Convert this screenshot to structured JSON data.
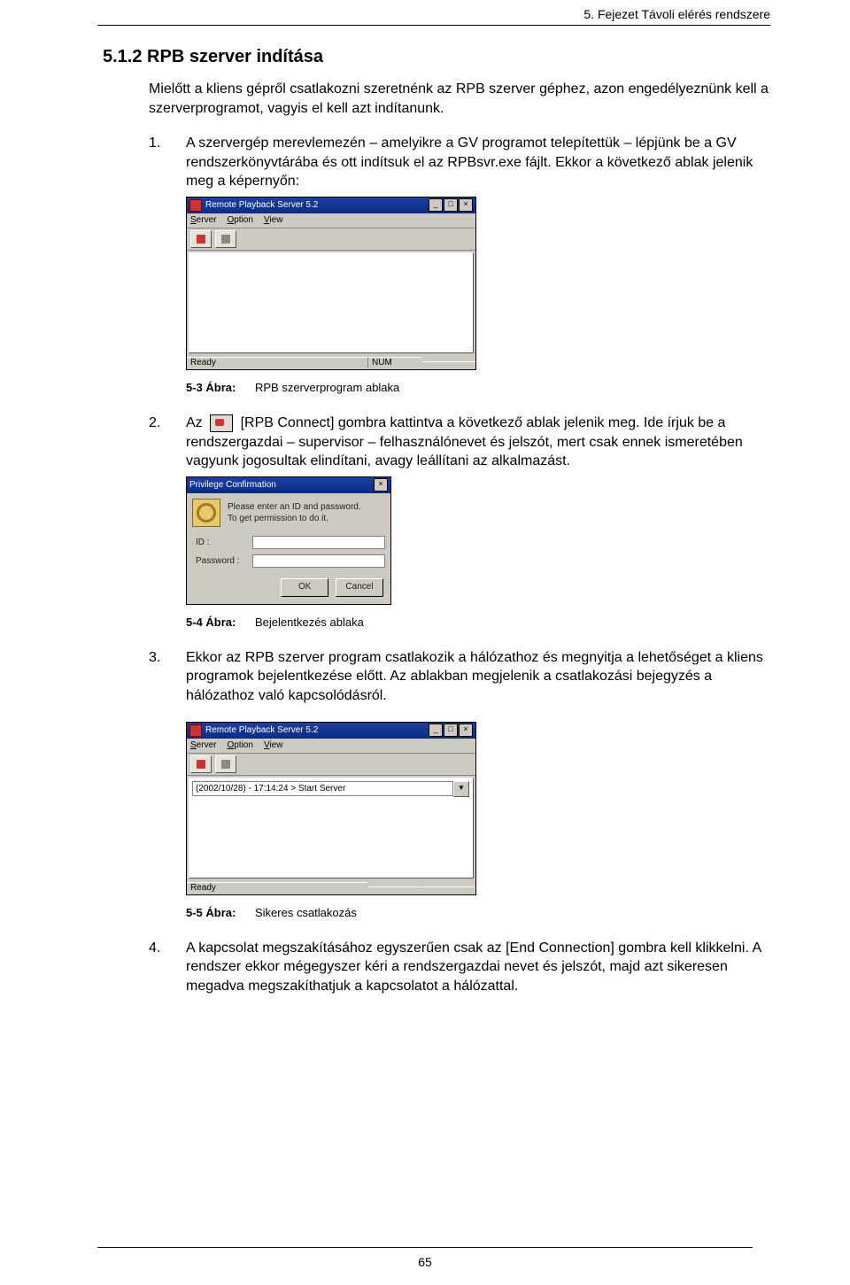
{
  "header": {
    "running": "5. Fejezet   Távoli elérés rendszere"
  },
  "section_title": "5.1.2 RPB szerver indítása",
  "intro": "Mielőtt a kliens gépről csatlakozni szeretnénk az RPB szerver géphez, azon engedélyeznünk kell a szerverprogramot, vagyis el kell azt indítanunk.",
  "item1": {
    "num": "1.",
    "text": "A szervergép merevlemezén – amelyikre a GV programot telepítettük – lépjünk be a GV rendszerkönyvtárába és ott indítsuk el az RPBsvr.exe fájlt. Ekkor a következő ablak jelenik meg a képernyőn:"
  },
  "fig1": {
    "title": "Remote Playback Server 5.2",
    "menus": {
      "server": "Server",
      "option": "Option",
      "view": "View"
    },
    "status_left": "Ready",
    "status_right": "NUM",
    "caption_label": "5-3 Ábra:",
    "caption_text": "RPB szerverprogram ablaka"
  },
  "item2": {
    "num": "2.",
    "pre": "Az",
    "post": "[RPB Connect] gombra kattintva a következő ablak jelenik meg. Ide írjuk be a rendszergazdai – supervisor – felhasználónevet és jelszót, mert csak ennek ismeretében vagyunk jogosultak elindítani, avagy leállítani az alkalmazást."
  },
  "dlg": {
    "title": "Privilege Confirmation",
    "msg1": "Please enter an ID and password.",
    "msg2": "To get permission to do it.",
    "label_id": "ID :",
    "label_pw": "Password :",
    "ok": "OK",
    "cancel": "Cancel",
    "caption_label": "5-4 Ábra:",
    "caption_text": "Bejelentkezés ablaka"
  },
  "item3": {
    "num": "3.",
    "text": "Ekkor az RPB szerver program csatlakozik a hálózathoz és megnyitja a lehetőséget a kliens programok bejelentkezése előtt. Az ablakban megjelenik a csatlakozási bejegyzés a hálózathoz való kapcsolódásról."
  },
  "fig2": {
    "title": "Remote Playback Server 5.2",
    "menus": {
      "server": "Server",
      "option": "Option",
      "view": "View"
    },
    "log": "(2002/10/28) - 17:14:24 > Start Server",
    "status_left": "Ready",
    "caption_label": "5-5 Ábra:",
    "caption_text": "Sikeres csatlakozás"
  },
  "item4": {
    "num": "4.",
    "text": "A kapcsolat megszakításához egyszerűen csak az [End Connection] gombra kell klikkelni. A rendszer ekkor mégegyszer kéri a rendszergazdai nevet és jelszót, majd azt sikeresen megadva megszakíthatjuk a kapcsolatot a hálózattal."
  },
  "page_number": "65"
}
